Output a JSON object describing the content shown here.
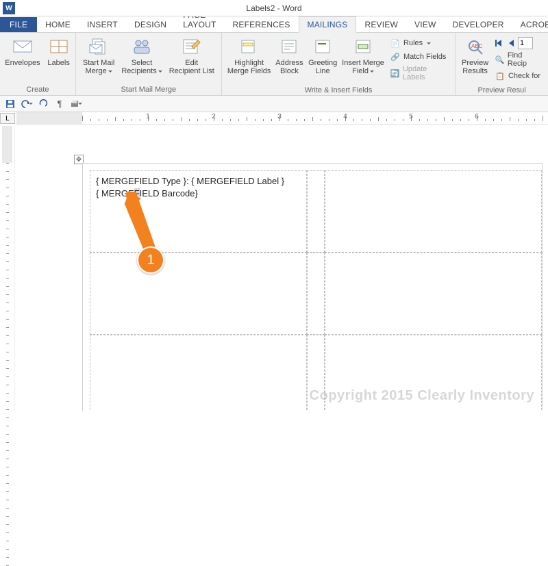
{
  "title": "Labels2 - Word",
  "tabs": {
    "file": "FILE",
    "home": "HOME",
    "insert": "INSERT",
    "design": "DESIGN",
    "page_layout": "PAGE LAYOUT",
    "references": "REFERENCES",
    "mailings": "MAILINGS",
    "review": "REVIEW",
    "view": "VIEW",
    "developer": "DEVELOPER",
    "acrobat": "ACROBAT"
  },
  "ribbon": {
    "create": {
      "envelopes": "Envelopes",
      "labels": "Labels",
      "name": "Create"
    },
    "start": {
      "start_mail_merge": "Start Mail\nMerge",
      "select_recipients": "Select\nRecipients",
      "edit_recipient_list": "Edit\nRecipient List",
      "name": "Start Mail Merge"
    },
    "write": {
      "highlight_merge_fields": "Highlight\nMerge Fields",
      "address_block": "Address\nBlock",
      "greeting_line": "Greeting\nLine",
      "insert_merge_field": "Insert Merge\nField",
      "rules": "Rules",
      "match_fields": "Match Fields",
      "update_labels": "Update Labels",
      "name": "Write & Insert Fields"
    },
    "preview": {
      "preview_results": "Preview\nResults",
      "record_value": "1",
      "find_recipient": "Find Recip",
      "check_errors": "Check for",
      "name": "Preview Resul"
    }
  },
  "document": {
    "line1_a": "{ MERGEFIELD Type }:  { MERGEFIELD Label }",
    "line2_pre": "{ MERGE",
    "line2_hl": "F",
    "line2_post": "IELD  Barcode}"
  },
  "callout": {
    "num": "1"
  },
  "watermark": "Copyright 2015 Clearly Inventory",
  "ruler": {
    "labels": [
      "1",
      "2",
      "3",
      "4",
      "5",
      "6"
    ]
  }
}
